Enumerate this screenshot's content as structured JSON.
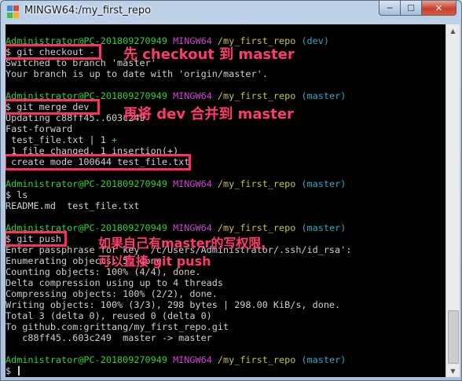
{
  "window": {
    "title": "MINGW64:/my_first_repo",
    "minimize_label": "─",
    "maximize_label": "☐",
    "close_label": "✕"
  },
  "colors": {
    "prompt_user": "#2fd13a",
    "prompt_env": "#c848c8",
    "prompt_path": "#c8c23a",
    "prompt_branch": "#2fa8c0",
    "annotation": "#ff3a6e"
  },
  "terminal": {
    "blocks": [
      {
        "prompt": {
          "user": "Administrator@PC-201809270949",
          "env": "MINGW64",
          "path": "/my_first_repo",
          "branch": "(dev)"
        },
        "command": "$ git checkout -",
        "output": [
          "Switched to branch 'master'",
          "Your branch is up to date with 'origin/master'."
        ]
      },
      {
        "prompt": {
          "user": "Administrator@PC-201809270949",
          "env": "MINGW64",
          "path": "/my_first_repo",
          "branch": "(master)"
        },
        "command": "$ git merge dev",
        "output": [
          "Updating c88ff45..603c249",
          "Fast-forward",
          " test_file.txt | 1 +",
          " 1 file changed, 1 insertion(+)",
          " create mode 100644 test_file.txt"
        ]
      },
      {
        "prompt": {
          "user": "Administrator@PC-201809270949",
          "env": "MINGW64",
          "path": "/my_first_repo",
          "branch": "(master)"
        },
        "command": "$ ls",
        "output": [
          "README.md  test_file.txt"
        ]
      },
      {
        "prompt": {
          "user": "Administrator@PC-201809270949",
          "env": "MINGW64",
          "path": "/my_first_repo",
          "branch": "(master)"
        },
        "command": "$ git push",
        "output": [
          "Enter passphrase for key '/c/Users/Administrator/.ssh/id_rsa':",
          "Enumerating objects: 5, done.",
          "Counting objects: 100% (4/4), done.",
          "Delta compression using up to 4 threads",
          "Compressing objects: 100% (2/2), done.",
          "Writing objects: 100% (3/3), 298 bytes | 298.00 KiB/s, done.",
          "Total 3 (delta 0), reused 0 (delta 0)",
          "To github.com:grittang/my_first_repo.git",
          "   c88ff45..603c249  master -> master"
        ]
      },
      {
        "prompt": {
          "user": "Administrator@PC-201809270949",
          "env": "MINGW64",
          "path": "/my_first_repo",
          "branch": "(master)"
        },
        "command": "$ ",
        "output": []
      }
    ]
  },
  "annotations": {
    "checkout_note": "先 checkout 到 master",
    "merge_note": "再将 dev 合并到 master",
    "push_note_line1": "如果自己有master的写权限,",
    "push_note_line2": "可以直接 git push"
  },
  "scrollbar": {
    "up_arrow": "▲",
    "down_arrow": "▼"
  }
}
